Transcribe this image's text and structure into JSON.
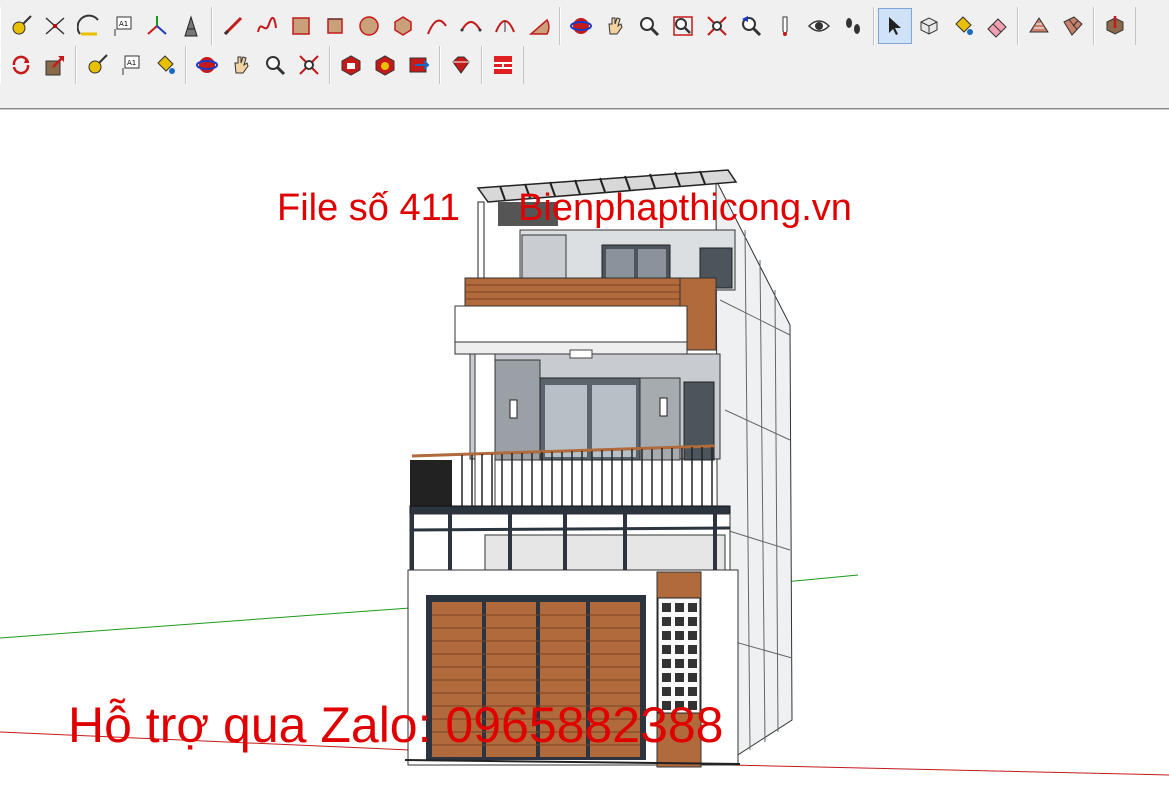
{
  "window": {
    "title": ""
  },
  "toolbar": {
    "row1_groups": [
      [
        "tape-measure-icon",
        "dimension-icon",
        "protractor-icon",
        "text-icon",
        "axes-icon",
        "3d-text-icon"
      ],
      [
        "pencil-line-icon",
        "freehand-icon",
        "rectangle-icon",
        "rotated-rectangle-icon",
        "circle-icon",
        "polygon-icon",
        "arc-icon",
        "two-point-arc-icon",
        "three-point-arc-icon",
        "pie-icon"
      ],
      [
        "orbit-icon",
        "pan-hand-icon",
        "zoom-icon",
        "zoom-window-icon",
        "zoom-extents-icon",
        "previous-view-icon",
        "position-camera-icon",
        "look-around-eye-icon",
        "walk-footprints-icon"
      ],
      [
        "select-arrow-icon",
        "make-component-icon",
        "paint-bucket-icon",
        "eraser-icon"
      ],
      [
        "sandbox-from-contours-icon",
        "sandbox-from-scratch-icon"
      ],
      [
        "export-icon"
      ]
    ],
    "row2_groups": [
      [
        "rotate-arrows-icon",
        "push-pull-icon"
      ],
      [
        "tape-measure-icon",
        "text-icon",
        "paint-bucket-icon"
      ],
      [
        "orbit-icon",
        "pan-hand-icon",
        "zoom-icon",
        "zoom-extents-icon"
      ],
      [
        "3d-warehouse-icon",
        "share-model-icon",
        "extension-warehouse-icon"
      ],
      [
        "ruby-console-icon"
      ],
      [
        "layout-icon"
      ]
    ],
    "active_tool": "select-arrow-icon"
  },
  "watermarks": {
    "file_label": "File số 411",
    "site": "Bienphapthicong.vn",
    "zalo": "Hỗ trợ qua Zalo: 0965882388"
  },
  "colors": {
    "watermark_red": "#e00000",
    "axis_green": "#1a9a1a",
    "axis_red": "#c41a1a",
    "wood": "#b06a3c",
    "toolbar_bg": "#f0f0f0"
  }
}
